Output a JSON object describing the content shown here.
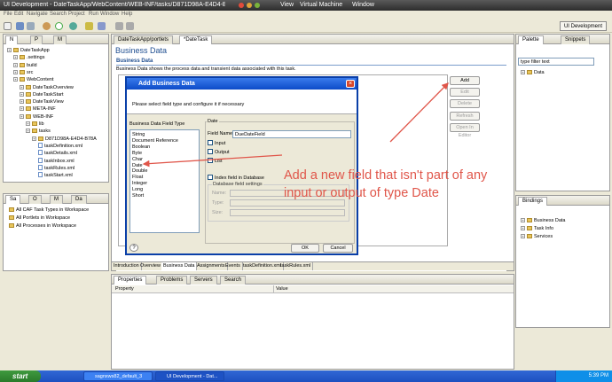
{
  "mac_bar": {
    "title": "UI Development - DateTaskApp/WebContent/WEB-INF/tasks/D871D98A-E4D4-B78",
    "view": "View",
    "vm": "Virtual Machine",
    "window": "Window"
  },
  "menu": [
    "File",
    "Edit",
    "Navigate",
    "Search",
    "Project",
    "Run",
    "Window",
    "Help"
  ],
  "perspective_button": "UI Development",
  "left_top_tabs": [
    "N",
    "P",
    "M"
  ],
  "tree": [
    {
      "label": "DateTaskApp",
      "depth": 0,
      "kind": "folder"
    },
    {
      "label": ".settings",
      "depth": 1,
      "kind": "folder"
    },
    {
      "label": "build",
      "depth": 1,
      "kind": "folder"
    },
    {
      "label": "src",
      "depth": 1,
      "kind": "folder"
    },
    {
      "label": "WebContent",
      "depth": 1,
      "kind": "folder"
    },
    {
      "label": "DateTaskOverview",
      "depth": 2,
      "kind": "folder"
    },
    {
      "label": "DateTaskStart",
      "depth": 2,
      "kind": "folder"
    },
    {
      "label": "DateTaskView",
      "depth": 2,
      "kind": "folder"
    },
    {
      "label": "META-INF",
      "depth": 2,
      "kind": "folder"
    },
    {
      "label": "WEB-INF",
      "depth": 2,
      "kind": "folder"
    },
    {
      "label": "lib",
      "depth": 3,
      "kind": "folder"
    },
    {
      "label": "tasks",
      "depth": 3,
      "kind": "folder"
    },
    {
      "label": "D871D98A-E4D4-B78A",
      "depth": 4,
      "kind": "folder"
    },
    {
      "label": "taskDefinition.xml",
      "depth": 5,
      "kind": "file"
    },
    {
      "label": "taskDetails.xml",
      "depth": 5,
      "kind": "file"
    },
    {
      "label": "taskInbox.xml",
      "depth": 5,
      "kind": "file"
    },
    {
      "label": "taskRules.xml",
      "depth": 5,
      "kind": "file"
    },
    {
      "label": "taskStart.xml",
      "depth": 5,
      "kind": "file"
    }
  ],
  "left_bottom_tabs": [
    "Sa",
    "O",
    "M",
    "Da"
  ],
  "left_bottom_items": [
    "All CAF Task Types in Workspace",
    "All Portlets in Workspace",
    "All Processes in Workspace"
  ],
  "editor_tabs": [
    "DateTaskApp/portlets",
    "*DateTask"
  ],
  "editor": {
    "heading": "Business Data",
    "section_title": "Business Data",
    "section_desc": "Business Data shows the process data and transient data associated with this task.",
    "buttons": [
      "Add",
      "Edit",
      "Delete",
      "Refresh",
      "Open In Editor"
    ],
    "bottom_tabs": [
      "Introduction",
      "Overview",
      "Business Data",
      "Assignments",
      "Events",
      "taskDefinition.xml",
      "taskRules.xml"
    ]
  },
  "dialog": {
    "title": "Add Business Data",
    "message": "Please select field type and configure it if necessary",
    "list_label": "Business Data Field Type",
    "types": [
      "String",
      "Document Reference",
      "Boolean",
      "Byte",
      "Char",
      "Date",
      "Double",
      "Float",
      "Integer",
      "Long",
      "Short"
    ],
    "group_label": "Date",
    "field_name_label": "Field Name:",
    "field_name_value": "DueDateField",
    "checks": [
      "Input",
      "Output",
      "List"
    ],
    "index_label": "Index field in Database",
    "db_settings": "Database field settings",
    "db_fields": [
      "Name:",
      "Type:",
      "Size:"
    ],
    "ok": "OK",
    "cancel": "Cancel"
  },
  "annotation": "Add a new field that isn't part of any input or output of type Date",
  "palette": {
    "tabs": [
      "Palette",
      "Snippets"
    ],
    "filter": "type filter text",
    "item": "Data"
  },
  "bindings": {
    "tab": "Bindings",
    "items": [
      "Business Data",
      "Task Info",
      "Services"
    ]
  },
  "bottom_panel": {
    "tabs": [
      "Properties",
      "Problems",
      "Servers",
      "Search"
    ],
    "col_property": "Property",
    "col_value": "Value"
  },
  "taskbar": {
    "start": "start",
    "tasks": [
      "sagnxws82_default_3",
      "UI Development - Dat..."
    ],
    "clock": "5:39 PM"
  },
  "colors": {
    "accent": "#1f4e90",
    "annotation": "#e0564a",
    "dialog_title": "#0c4bc8"
  }
}
